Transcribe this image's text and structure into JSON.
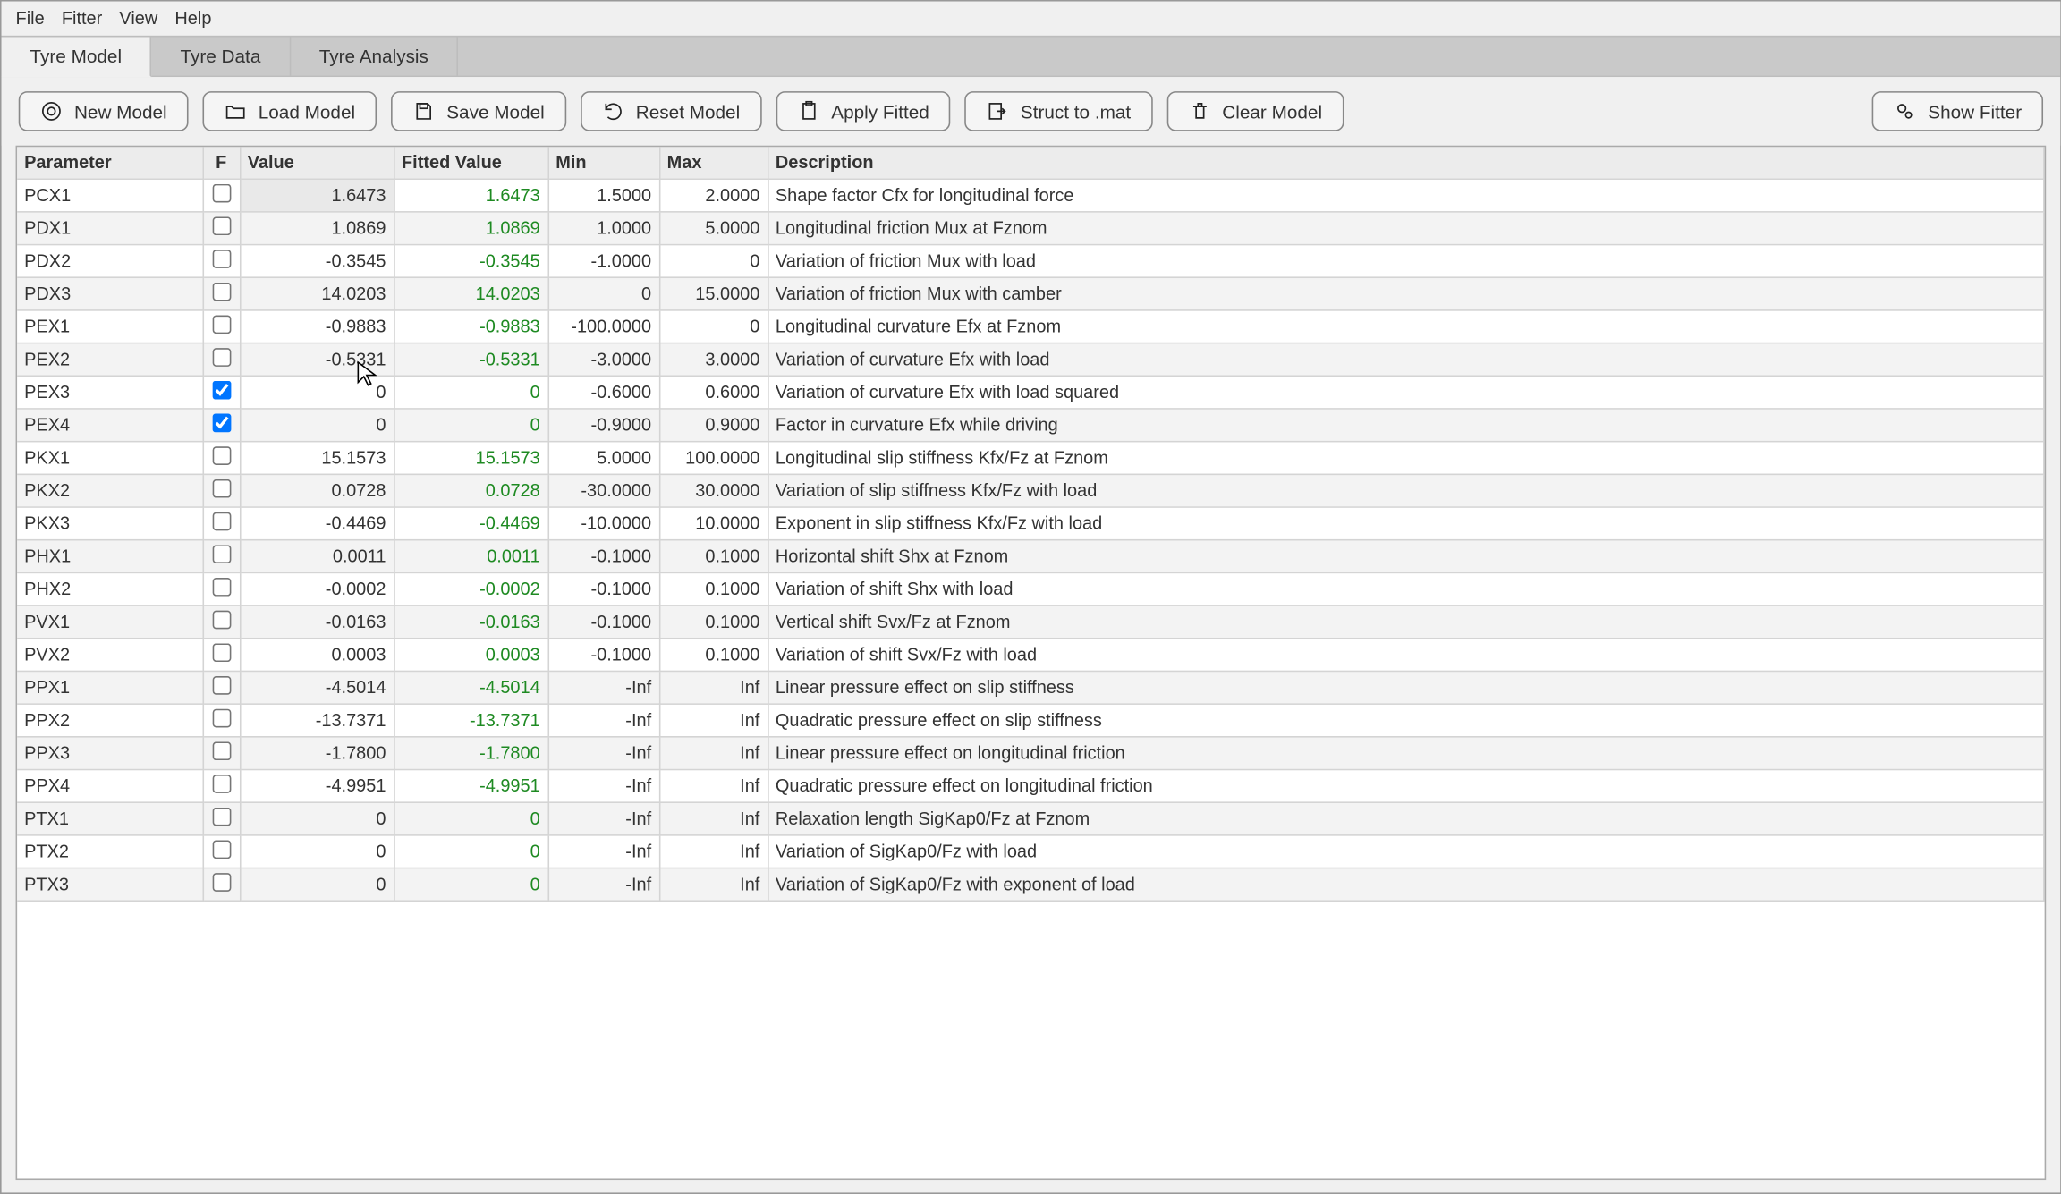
{
  "menu": {
    "items": [
      "File",
      "Fitter",
      "View",
      "Help"
    ]
  },
  "tabs": [
    {
      "label": "Tyre Model",
      "active": true
    },
    {
      "label": "Tyre Data",
      "active": false
    },
    {
      "label": "Tyre Analysis",
      "active": false
    }
  ],
  "toolbar": {
    "new_model": "New Model",
    "load_model": "Load Model",
    "save_model": "Save Model",
    "reset_model": "Reset Model",
    "apply_fitted": "Apply Fitted",
    "struct_to_mat": "Struct to .mat",
    "clear_model": "Clear Model",
    "show_fitter": "Show Fitter"
  },
  "columns": {
    "parameter": "Parameter",
    "f": "F",
    "value": "Value",
    "fitted": "Fitted Value",
    "min": "Min",
    "max": "Max",
    "description": "Description"
  },
  "rows": [
    {
      "param": "PCX1",
      "f": false,
      "value": "1.6473",
      "fitted": "1.6473",
      "min": "1.5000",
      "max": "2.0000",
      "desc": "Shape factor Cfx for longitudinal force"
    },
    {
      "param": "PDX1",
      "f": false,
      "value": "1.0869",
      "fitted": "1.0869",
      "min": "1.0000",
      "max": "5.0000",
      "desc": "Longitudinal friction Mux at Fznom"
    },
    {
      "param": "PDX2",
      "f": false,
      "value": "-0.3545",
      "fitted": "-0.3545",
      "min": "-1.0000",
      "max": "0",
      "desc": "Variation of friction Mux with load"
    },
    {
      "param": "PDX3",
      "f": false,
      "value": "14.0203",
      "fitted": "14.0203",
      "min": "0",
      "max": "15.0000",
      "desc": "Variation of friction Mux with camber"
    },
    {
      "param": "PEX1",
      "f": false,
      "value": "-0.9883",
      "fitted": "-0.9883",
      "min": "-100.0000",
      "max": "0",
      "desc": "Longitudinal curvature Efx at Fznom"
    },
    {
      "param": "PEX2",
      "f": false,
      "value": "-0.5331",
      "fitted": "-0.5331",
      "min": "-3.0000",
      "max": "3.0000",
      "desc": "Variation of curvature Efx with load"
    },
    {
      "param": "PEX3",
      "f": true,
      "value": "0",
      "fitted": "0",
      "min": "-0.6000",
      "max": "0.6000",
      "desc": "Variation of curvature Efx with load squared"
    },
    {
      "param": "PEX4",
      "f": true,
      "value": "0",
      "fitted": "0",
      "min": "-0.9000",
      "max": "0.9000",
      "desc": "Factor in curvature Efx while driving"
    },
    {
      "param": "PKX1",
      "f": false,
      "value": "15.1573",
      "fitted": "15.1573",
      "min": "5.0000",
      "max": "100.0000",
      "desc": "Longitudinal slip stiffness Kfx/Fz at Fznom"
    },
    {
      "param": "PKX2",
      "f": false,
      "value": "0.0728",
      "fitted": "0.0728",
      "min": "-30.0000",
      "max": "30.0000",
      "desc": "Variation of slip stiffness Kfx/Fz with load"
    },
    {
      "param": "PKX3",
      "f": false,
      "value": "-0.4469",
      "fitted": "-0.4469",
      "min": "-10.0000",
      "max": "10.0000",
      "desc": "Exponent in slip stiffness Kfx/Fz with load"
    },
    {
      "param": "PHX1",
      "f": false,
      "value": "0.0011",
      "fitted": "0.0011",
      "min": "-0.1000",
      "max": "0.1000",
      "desc": "Horizontal shift Shx at Fznom"
    },
    {
      "param": "PHX2",
      "f": false,
      "value": "-0.0002",
      "fitted": "-0.0002",
      "min": "-0.1000",
      "max": "0.1000",
      "desc": "Variation of shift Shx with load"
    },
    {
      "param": "PVX1",
      "f": false,
      "value": "-0.0163",
      "fitted": "-0.0163",
      "min": "-0.1000",
      "max": "0.1000",
      "desc": "Vertical shift Svx/Fz at Fznom"
    },
    {
      "param": "PVX2",
      "f": false,
      "value": "0.0003",
      "fitted": "0.0003",
      "min": "-0.1000",
      "max": "0.1000",
      "desc": "Variation of shift Svx/Fz with load"
    },
    {
      "param": "PPX1",
      "f": false,
      "value": "-4.5014",
      "fitted": "-4.5014",
      "min": "-Inf",
      "max": "Inf",
      "desc": "Linear pressure effect on slip stiffness"
    },
    {
      "param": "PPX2",
      "f": false,
      "value": "-13.7371",
      "fitted": "-13.7371",
      "min": "-Inf",
      "max": "Inf",
      "desc": "Quadratic pressure effect on slip stiffness"
    },
    {
      "param": "PPX3",
      "f": false,
      "value": "-1.7800",
      "fitted": "-1.7800",
      "min": "-Inf",
      "max": "Inf",
      "desc": "Linear pressure effect on longitudinal friction"
    },
    {
      "param": "PPX4",
      "f": false,
      "value": "-4.9951",
      "fitted": "-4.9951",
      "min": "-Inf",
      "max": "Inf",
      "desc": "Quadratic pressure effect on longitudinal friction"
    },
    {
      "param": "PTX1",
      "f": false,
      "value": "0",
      "fitted": "0",
      "min": "-Inf",
      "max": "Inf",
      "desc": "Relaxation length SigKap0/Fz at Fznom"
    },
    {
      "param": "PTX2",
      "f": false,
      "value": "0",
      "fitted": "0",
      "min": "-Inf",
      "max": "Inf",
      "desc": "Variation of SigKap0/Fz with load"
    },
    {
      "param": "PTX3",
      "f": false,
      "value": "0",
      "fitted": "0",
      "min": "-Inf",
      "max": "Inf",
      "desc": "Variation of SigKap0/Fz with exponent of load"
    }
  ]
}
